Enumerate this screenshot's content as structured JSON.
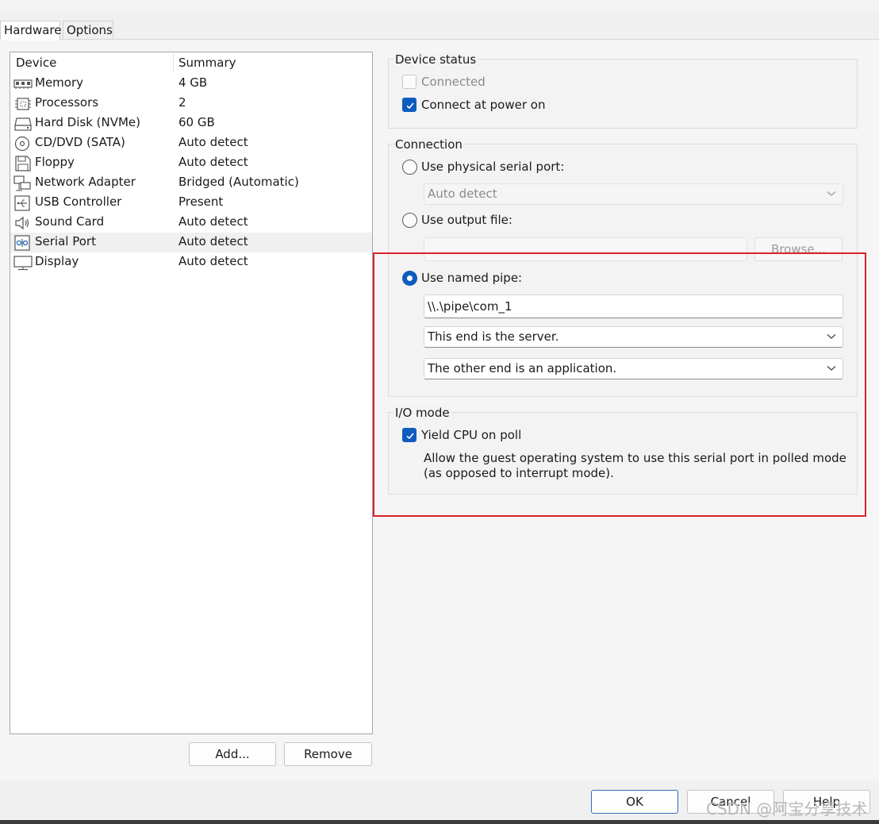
{
  "tabs": [
    {
      "label": "Hardware",
      "active": true
    },
    {
      "label": "Options",
      "active": false
    }
  ],
  "device_list": {
    "headers": {
      "device": "Device",
      "summary": "Summary"
    },
    "rows": [
      {
        "name": "Memory",
        "summary": "4 GB",
        "icon": "memory-icon"
      },
      {
        "name": "Processors",
        "summary": "2",
        "icon": "processor-icon"
      },
      {
        "name": "Hard Disk (NVMe)",
        "summary": "60 GB",
        "icon": "hard-disk-icon"
      },
      {
        "name": "CD/DVD (SATA)",
        "summary": "Auto detect",
        "icon": "cd-dvd-icon"
      },
      {
        "name": "Floppy",
        "summary": "Auto detect",
        "icon": "floppy-icon"
      },
      {
        "name": "Network Adapter",
        "summary": "Bridged (Automatic)",
        "icon": "network-adapter-icon"
      },
      {
        "name": "USB Controller",
        "summary": "Present",
        "icon": "usb-icon"
      },
      {
        "name": "Sound Card",
        "summary": "Auto detect",
        "icon": "sound-icon"
      },
      {
        "name": "Serial Port",
        "summary": "Auto detect",
        "icon": "serial-port-icon",
        "selected": true
      },
      {
        "name": "Display",
        "summary": "Auto detect",
        "icon": "display-icon"
      }
    ],
    "add_label": "Add...",
    "remove_label": "Remove"
  },
  "device_status": {
    "title": "Device status",
    "connected": {
      "label": "Connected",
      "checked": false,
      "enabled": false
    },
    "connect_at_power_on": {
      "label": "Connect at power on",
      "checked": true
    }
  },
  "connection": {
    "title": "Connection",
    "physical": {
      "label": "Use physical serial port:",
      "selected": false,
      "combo_value": "Auto detect"
    },
    "output_file": {
      "label": "Use output file:",
      "selected": false,
      "value": "",
      "browse_label": "Browse..."
    },
    "named_pipe": {
      "label": "Use named pipe:",
      "selected": true,
      "pipe_name": "\\\\.\\pipe\\com_1",
      "this_end": "This end is the server.",
      "other_end": "The other end is an application."
    }
  },
  "io_mode": {
    "title": "I/O mode",
    "yield_cpu": {
      "label": "Yield CPU on poll",
      "checked": true
    },
    "description": "Allow the guest operating system to use this serial port in polled mode (as opposed to interrupt mode)."
  },
  "footer": {
    "ok": "OK",
    "cancel": "Cancel",
    "help": "Help"
  },
  "watermark": "CSDN @阿宝分享技术",
  "colors": {
    "accent": "#0f5cbf",
    "highlight": "#d9232d"
  }
}
